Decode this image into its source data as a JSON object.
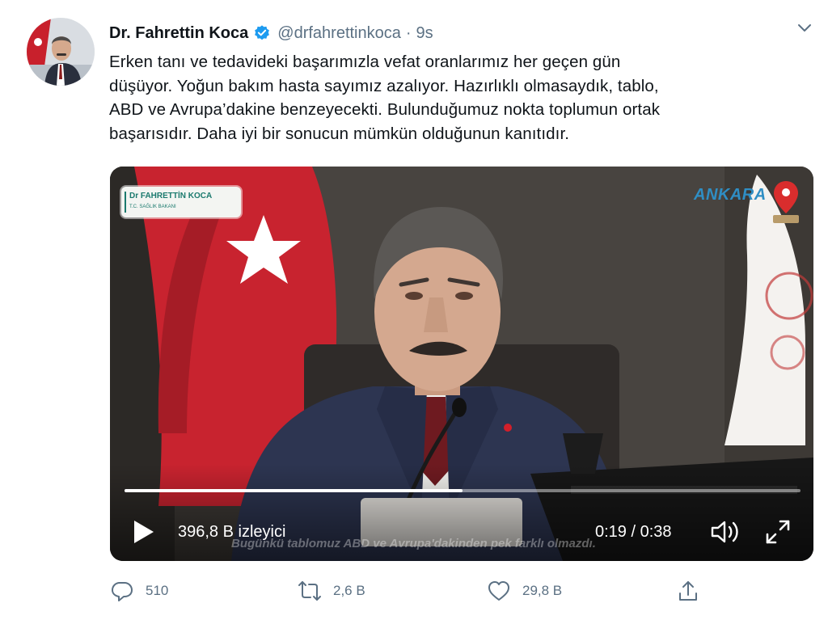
{
  "tweet": {
    "author_name": "Dr. Fahrettin Koca",
    "handle": "@drfahrettinkoca",
    "separator": "·",
    "timestamp": "9s",
    "text_lines": [
      "Erken tanı ve tedavideki başarımızla vefat oranlarımız her geçen gün",
      "düşüyor. Yoğun bakım hasta sayımız azalıyor. Hazırlıklı olmasaydık, tablo,",
      "ABD ve Avrupa’dakine benzeyecekti. Bulunduğumuz nokta toplumun ortak",
      "başarısıdır. Daha iyi bir sonucun mümkün olduğunun kanıtıdır."
    ],
    "avatar_icon": "profile-photo",
    "verified_icon": "verified-badge-icon",
    "more_icon": "chevron-down-icon"
  },
  "video": {
    "lower_third_name": "Dr FAHRETTİN KOCA",
    "lower_third_title": "T.C. SAĞLIK BAKANI",
    "location": "ANKARA",
    "subtitle": "Bugünkü tablomuz ABD ve Avrupa'dakinden pek farklı olmazdı.",
    "views": "396,8 B izleyici",
    "time": "0:19 / 0:38",
    "progress": 0.5,
    "play_icon": "play-icon",
    "volume_icon": "volume-icon",
    "fullscreen_icon": "fullscreen-icon"
  },
  "actions": {
    "reply_count": "510",
    "retweet_count": "2,6 B",
    "like_count": "29,8 B"
  },
  "colors": {
    "text": "#0f1419",
    "secondary": "#5b7083",
    "verified": "#1d9bf0"
  }
}
